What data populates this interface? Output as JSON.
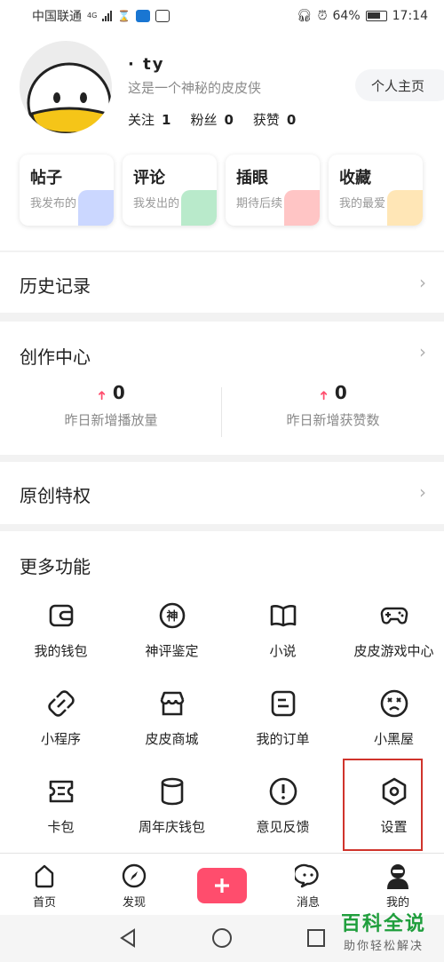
{
  "status_bar": {
    "carrier": "中国联通",
    "network": "4G",
    "battery": "64%",
    "time": "17:14"
  },
  "profile": {
    "username": "·  ty",
    "bio": "这是一个神秘的皮皮侠",
    "homepage_button": "个人主页",
    "stats": [
      {
        "label": "关注",
        "value": "1"
      },
      {
        "label": "粉丝",
        "value": "0"
      },
      {
        "label": "获赞",
        "value": "0"
      }
    ]
  },
  "cards": [
    {
      "title": "帖子",
      "subtitle": "我发布的",
      "color": "#6b8cff"
    },
    {
      "title": "评论",
      "subtitle": "我发出的",
      "color": "#37c36b"
    },
    {
      "title": "插眼",
      "subtitle": "期待后续",
      "color": "#ff5a5a"
    },
    {
      "title": "收藏",
      "subtitle": "我的最爱",
      "color": "#ffb62e"
    }
  ],
  "history": {
    "title": "历史记录"
  },
  "creation": {
    "title": "创作中心",
    "metrics": [
      {
        "value": "0",
        "label": "昨日新增播放量"
      },
      {
        "value": "0",
        "label": "昨日新增获赞数"
      }
    ]
  },
  "original": {
    "title": "原创特权"
  },
  "more": {
    "title": "更多功能",
    "items": [
      {
        "label": "我的钱包",
        "icon": "wallet-icon"
      },
      {
        "label": "神评鉴定",
        "icon": "shen-badge-icon",
        "glyph": "神"
      },
      {
        "label": "小说",
        "icon": "book-icon"
      },
      {
        "label": "皮皮游戏中心",
        "icon": "gamepad-icon"
      },
      {
        "label": "小程序",
        "icon": "link-icon"
      },
      {
        "label": "皮皮商城",
        "icon": "shop-icon"
      },
      {
        "label": "我的订单",
        "icon": "order-icon"
      },
      {
        "label": "小黑屋",
        "icon": "dizzy-face-icon"
      },
      {
        "label": "卡包",
        "icon": "card-pack-icon"
      },
      {
        "label": "周年庆钱包",
        "icon": "cup-icon"
      },
      {
        "label": "意见反馈",
        "icon": "feedback-icon"
      },
      {
        "label": "设置",
        "icon": "settings-icon"
      }
    ]
  },
  "tabbar": {
    "tabs": [
      {
        "label": "首页",
        "icon": "home-icon"
      },
      {
        "label": "发现",
        "icon": "compass-icon"
      },
      {
        "label": "消息",
        "icon": "message-icon"
      },
      {
        "label": "我的",
        "icon": "profile-icon"
      }
    ],
    "publish_icon": "plus-icon",
    "accent": "#ff4d6d"
  },
  "watermark": {
    "line1": "百科全说",
    "line2": "助你轻松解决"
  }
}
